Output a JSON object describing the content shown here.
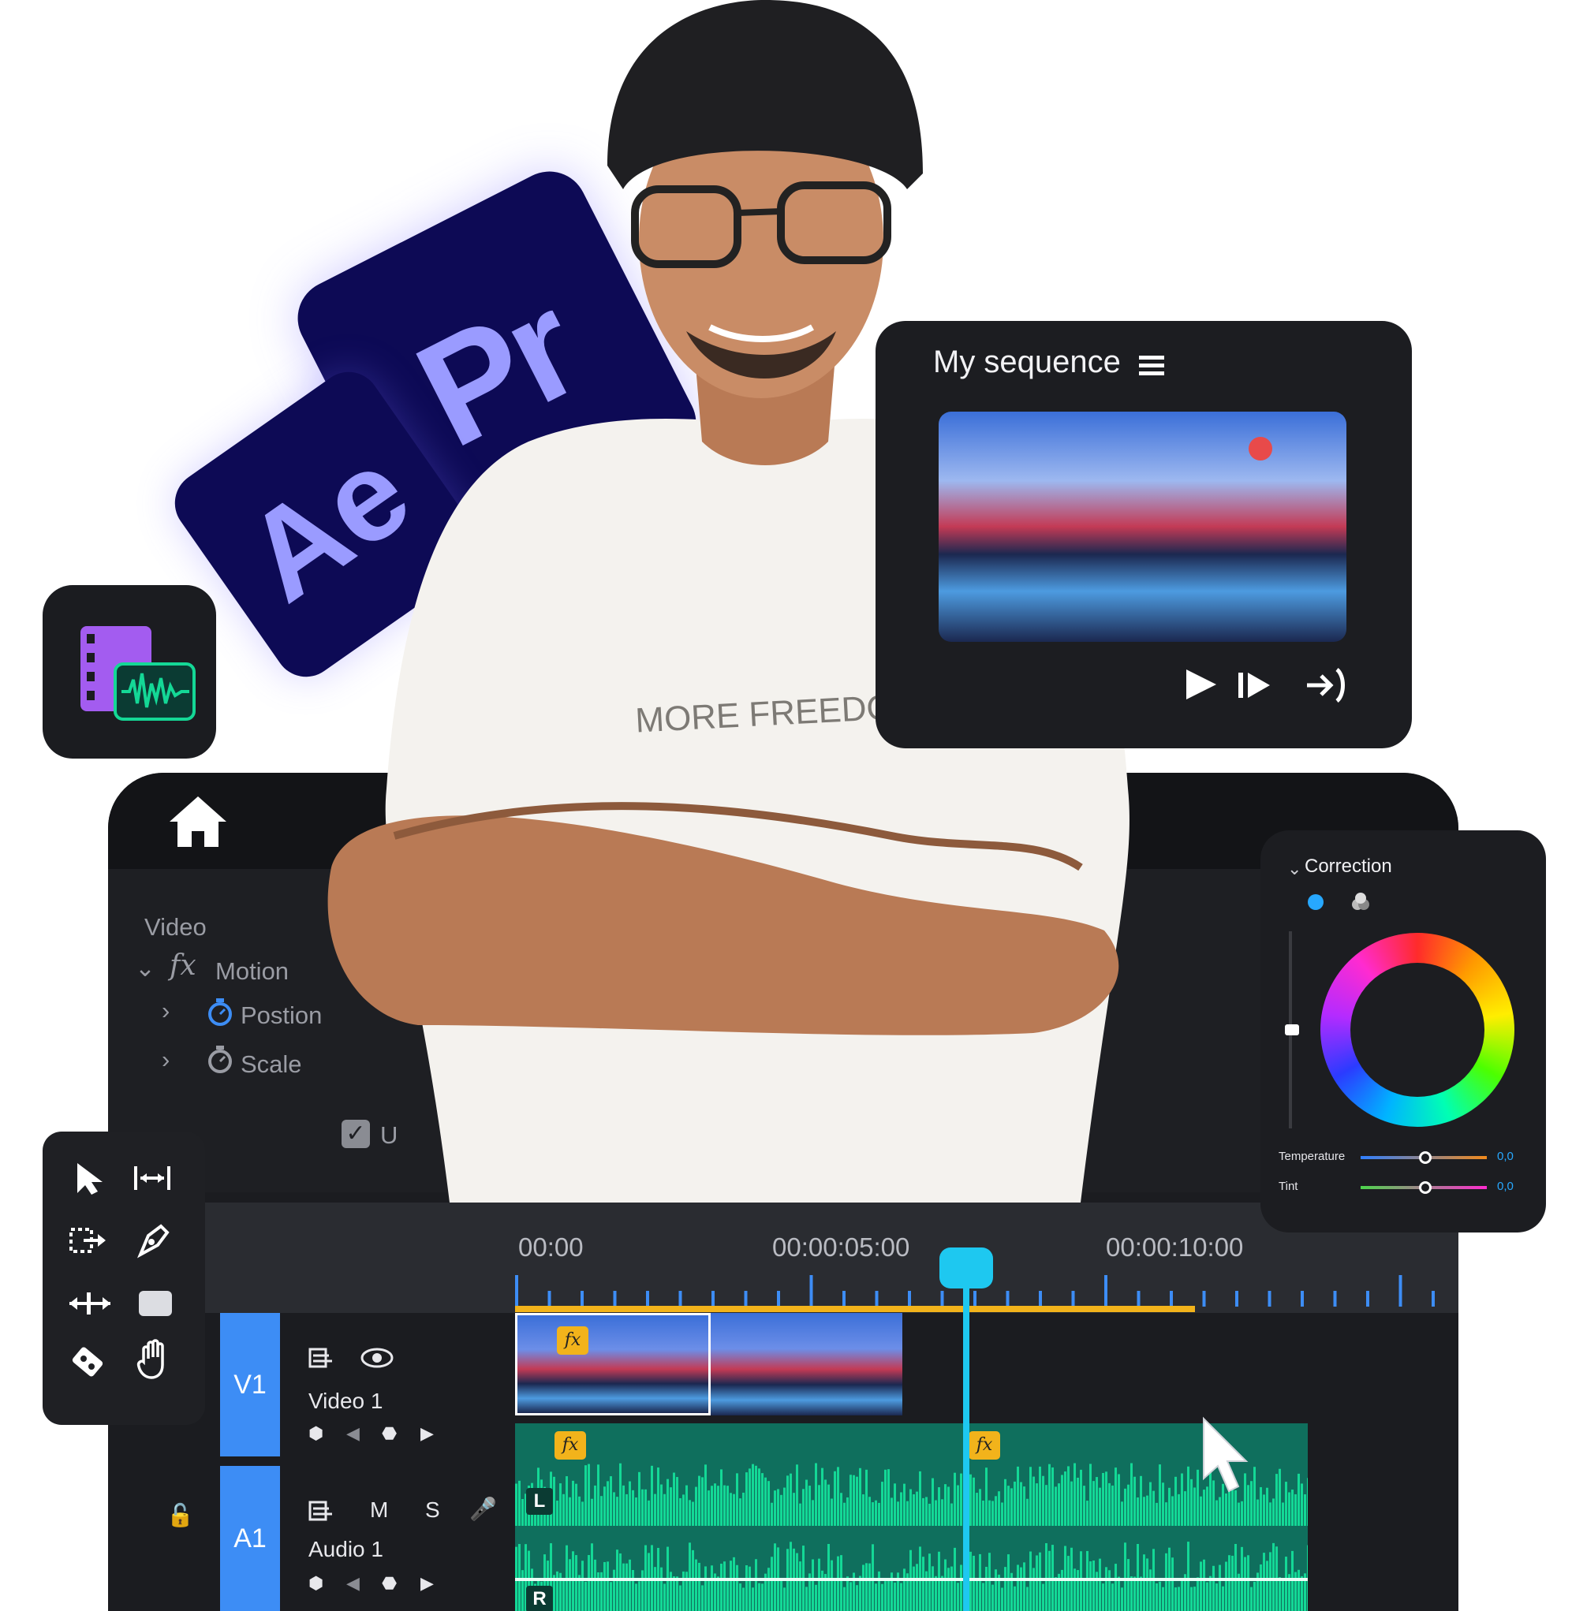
{
  "logos": {
    "ae": "Ae",
    "pr": "Pr"
  },
  "tshirt": {
    "text": "MORE FREEDOM"
  },
  "sequence_panel": {
    "title": "My sequence",
    "menu_icon": "hamburger-icon",
    "controls": [
      "play-icon",
      "step-forward-icon",
      "go-to-out-icon"
    ]
  },
  "effects_panel": {
    "home_icon": "home-icon",
    "section": "Video",
    "effect": "Motion",
    "properties": [
      "Postion",
      "Scale"
    ],
    "checkbox_partial": "U"
  },
  "correction_panel": {
    "header": "Correction",
    "temperature_label": "Temperature",
    "temperature_value": "0,0",
    "tint_label": "Tint",
    "tint_value": "0,0"
  },
  "timeline": {
    "timecodes": [
      "00:00",
      "00:00:05:00",
      "00:00:10:00"
    ],
    "playhead_color": "#1ec8f0",
    "work_area_color": "#f2b31b"
  },
  "tracks": {
    "video": {
      "id": "V1",
      "name": "Video 1"
    },
    "audio": {
      "id": "A1",
      "name": "Audio 1",
      "mute": "M",
      "solo": "S",
      "left": "L",
      "right": "R"
    }
  },
  "colors": {
    "accent_blue": "#3d8df5",
    "audio_green": "#14d896",
    "audio_bg": "#0f6f5d",
    "logo_bg": "#0d0a55",
    "logo_text": "#9a9bff"
  }
}
